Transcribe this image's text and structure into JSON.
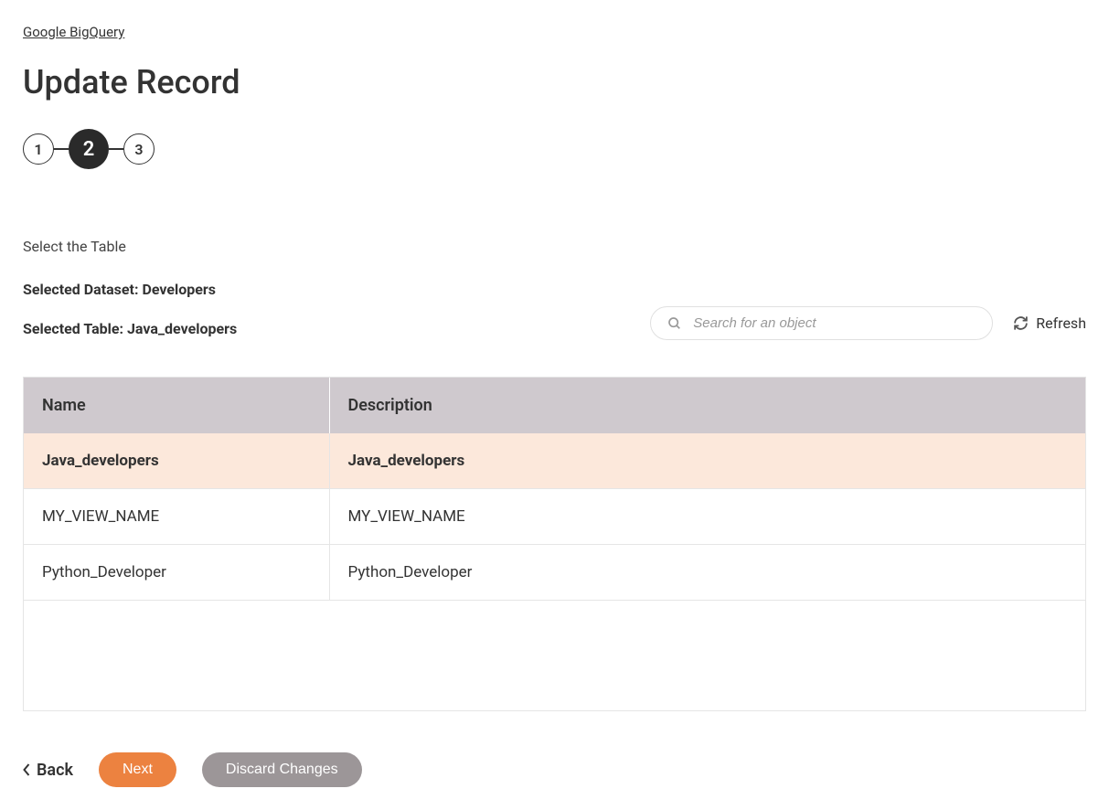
{
  "breadcrumb": "Google BigQuery",
  "page_title": "Update Record",
  "stepper": {
    "steps": [
      "1",
      "2",
      "3"
    ],
    "active_index": 1
  },
  "section_label": "Select the Table",
  "selected_dataset_label": "Selected Dataset: Developers",
  "selected_table_label": "Selected Table: Java_developers",
  "search": {
    "placeholder": "Search for an object"
  },
  "refresh_label": "Refresh",
  "table": {
    "columns": [
      "Name",
      "Description"
    ],
    "rows": [
      {
        "name": "Java_developers",
        "description": "Java_developers",
        "selected": true
      },
      {
        "name": "MY_VIEW_NAME",
        "description": "MY_VIEW_NAME",
        "selected": false
      },
      {
        "name": "Python_Developer",
        "description": "Python_Developer",
        "selected": false
      }
    ]
  },
  "footer": {
    "back": "Back",
    "next": "Next",
    "discard": "Discard Changes"
  }
}
